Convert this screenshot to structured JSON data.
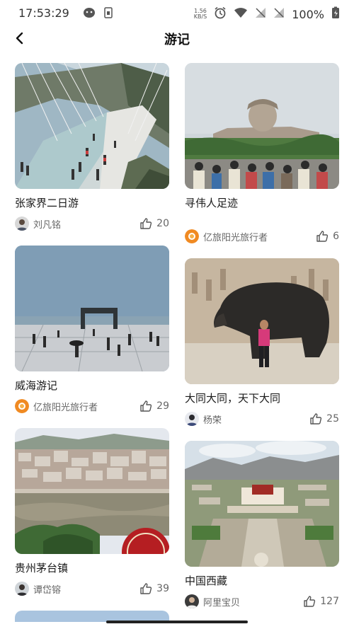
{
  "status_bar": {
    "time": "17:53:29",
    "speed_value": "1.56",
    "speed_unit": "KB/S",
    "battery": "100%"
  },
  "header": {
    "title": "游记"
  },
  "posts": [
    {
      "title": "张家界二日游",
      "author": "刘凡铭",
      "likes": "20",
      "image": "glass-bridge-photo",
      "avatar": "person-avatar"
    },
    {
      "title": "寻伟人足迹",
      "author": "亿旅阳光旅行者",
      "likes": "6",
      "image": "statue-monument-photo",
      "avatar": "sun-logo-avatar"
    },
    {
      "title": "威海游记",
      "author": "亿旅阳光旅行者",
      "likes": "29",
      "image": "seaside-plaza-photo",
      "avatar": "sun-logo-avatar"
    },
    {
      "title": "大同大同，天下大同",
      "author": "杨荣",
      "likes": "25",
      "image": "bronze-ox-photo",
      "avatar": "person-avatar"
    },
    {
      "title": "贵州茅台镇",
      "author": "谭岱镕",
      "likes": "39",
      "image": "river-town-photo",
      "avatar": "person-avatar"
    },
    {
      "title": "中国西藏",
      "author": "阿里宝贝",
      "likes": "127",
      "image": "potala-palace-photo",
      "avatar": "person-avatar"
    }
  ],
  "colors": {
    "accent_avatar": "#f07d1a",
    "text_primary": "#1a1a1a",
    "text_secondary": "#666666"
  }
}
